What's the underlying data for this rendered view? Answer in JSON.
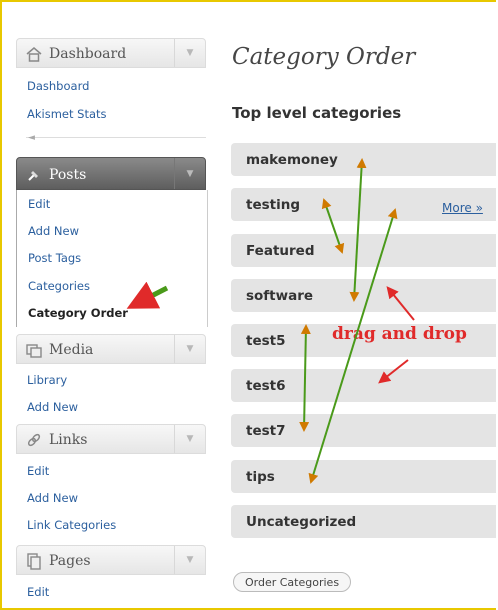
{
  "sidebar": {
    "dashboard": {
      "label": "Dashboard",
      "items": [
        "Dashboard",
        "Akismet Stats"
      ]
    },
    "posts": {
      "label": "Posts",
      "items": [
        "Edit",
        "Add New",
        "Post Tags",
        "Categories",
        "Category Order"
      ],
      "current": "Category Order"
    },
    "media": {
      "label": "Media",
      "items": [
        "Library",
        "Add New"
      ]
    },
    "links": {
      "label": "Links",
      "items": [
        "Edit",
        "Add New",
        "Link Categories"
      ]
    },
    "pages": {
      "label": "Pages",
      "items": [
        "Edit"
      ]
    }
  },
  "main": {
    "title": "Category Order",
    "subtitle": "Top level categories",
    "categories": [
      "makemoney",
      "testing",
      "Featured",
      "software",
      "test5",
      "test6",
      "test7",
      "tips",
      "Uncategorized"
    ],
    "more_link": "More »",
    "order_button": "Order Categories"
  },
  "annotation": {
    "text": "drag and drop",
    "color": "#e02a2a"
  },
  "colors": {
    "arrow_green": "#4a9a1a",
    "arrow_head": "#d07a00",
    "frame": "#e8c800",
    "link": "#2b5f9e"
  }
}
